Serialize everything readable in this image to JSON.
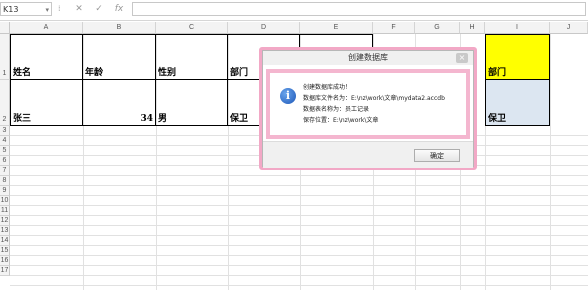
{
  "formula_bar": {
    "name_box": "K13",
    "icons": [
      "cancel-icon",
      "confirm-icon",
      "fx-icon"
    ],
    "fx_label": "fx"
  },
  "columns": [
    "A",
    "B",
    "C",
    "D",
    "E",
    "F",
    "G",
    "H",
    "I",
    "J"
  ],
  "rows": [
    "1",
    "2",
    "3",
    "4",
    "5",
    "6",
    "7",
    "8",
    "9",
    "10",
    "11",
    "12",
    "13",
    "14",
    "15",
    "16",
    "17"
  ],
  "sheet": {
    "a1": "姓名",
    "b1": "年龄",
    "c1": "性别",
    "d1": "部门",
    "a2": "张三",
    "b2": "34",
    "c2": "男",
    "d2": "保卫",
    "i1": "部门",
    "i2": "保卫"
  },
  "colors": {
    "i1_fill": "#ffff00",
    "i2_fill": "#dce6f1",
    "highlight": "#f2a8c6"
  },
  "dialog": {
    "title": "创建数据库",
    "close_glyph": "×",
    "icon": "info-icon",
    "lines": [
      "创建数据库成功！",
      "数据库文件名为：E:\\nz\\work\\文章\\mydata2.accdb",
      "数据表名称为：员工记录",
      "保存位置：E:\\nz\\work\\文章"
    ],
    "ok_label": "确定"
  }
}
